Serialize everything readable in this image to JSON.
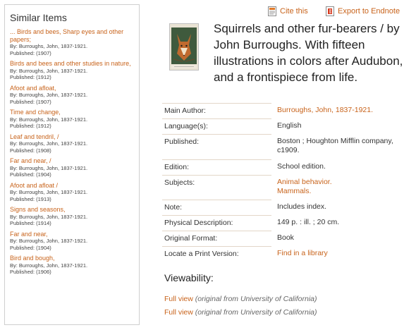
{
  "sidebar": {
    "title": "Similar Items",
    "items": [
      {
        "title": "... Birds and bees, Sharp eyes and other papers;",
        "author": "By: Burroughs, John, 1837-1921.",
        "published": "Published: (1907)"
      },
      {
        "title": "Birds and bees and other studies in nature,",
        "author": "By: Burroughs, John, 1837-1921.",
        "published": "Published: (1912)"
      },
      {
        "title": "Afoot and afloat,",
        "author": "By: Burroughs, John, 1837-1921.",
        "published": "Published: (1907)"
      },
      {
        "title": "Time and change,",
        "author": "By: Burroughs, John, 1837-1921.",
        "published": "Published: (1912)"
      },
      {
        "title": "Leaf and tendril, /",
        "author": "By: Burroughs, John, 1837-1921.",
        "published": "Published: (1908)"
      },
      {
        "title": "Far and near, /",
        "author": "By: Burroughs, John, 1837-1921.",
        "published": "Published: (1904)"
      },
      {
        "title": "Afoot and afloat /",
        "author": "By: Burroughs, John, 1837-1921.",
        "published": "Published: (1913)"
      },
      {
        "title": "Signs and seasons,",
        "author": "By: Burroughs, John, 1837-1921.",
        "published": "Published: (1914)"
      },
      {
        "title": "Far and near,",
        "author": "By: Burroughs, John, 1837-1921.",
        "published": "Published: (1904)"
      },
      {
        "title": "Bird and bough,",
        "author": "By: Burroughs, John, 1837-1921.",
        "published": "Published: (1906)"
      }
    ]
  },
  "actions": {
    "cite": "Cite this",
    "export": "Export to Endnote"
  },
  "book": {
    "title": "Squirrels and other fur-bearers / by John Burroughs. With fifteen illustrations in colors after Audubon, and a frontispiece from life."
  },
  "details": {
    "main_author_label": "Main Author:",
    "main_author": "Burroughs, John, 1837-1921.",
    "language_label": "Language(s):",
    "language": "English",
    "published_label": "Published:",
    "published_line1": "Boston ; Houghton Mifflin company,",
    "published_line2": "c1909.",
    "edition_label": "Edition:",
    "edition": "School edition.",
    "subjects_label": "Subjects:",
    "subject1": "Animal behavior.",
    "subject2": "Mammals.",
    "note_label": "Note:",
    "note": "Includes index.",
    "physical_label": "Physical Description:",
    "physical": "149 p. : ill. ; 20 cm.",
    "format_label": "Original Format:",
    "format": "Book",
    "locate_label": "Locate a Print Version:",
    "locate": "Find in a library"
  },
  "viewability": {
    "title": "Viewability:",
    "links": [
      {
        "label": "Full view",
        "source": "(original from University of California)"
      },
      {
        "label": "Full view",
        "source": "(original from University of California)"
      }
    ]
  },
  "colors": {
    "link": "#c8631b",
    "text": "#333333",
    "border": "#cfcfcf"
  }
}
